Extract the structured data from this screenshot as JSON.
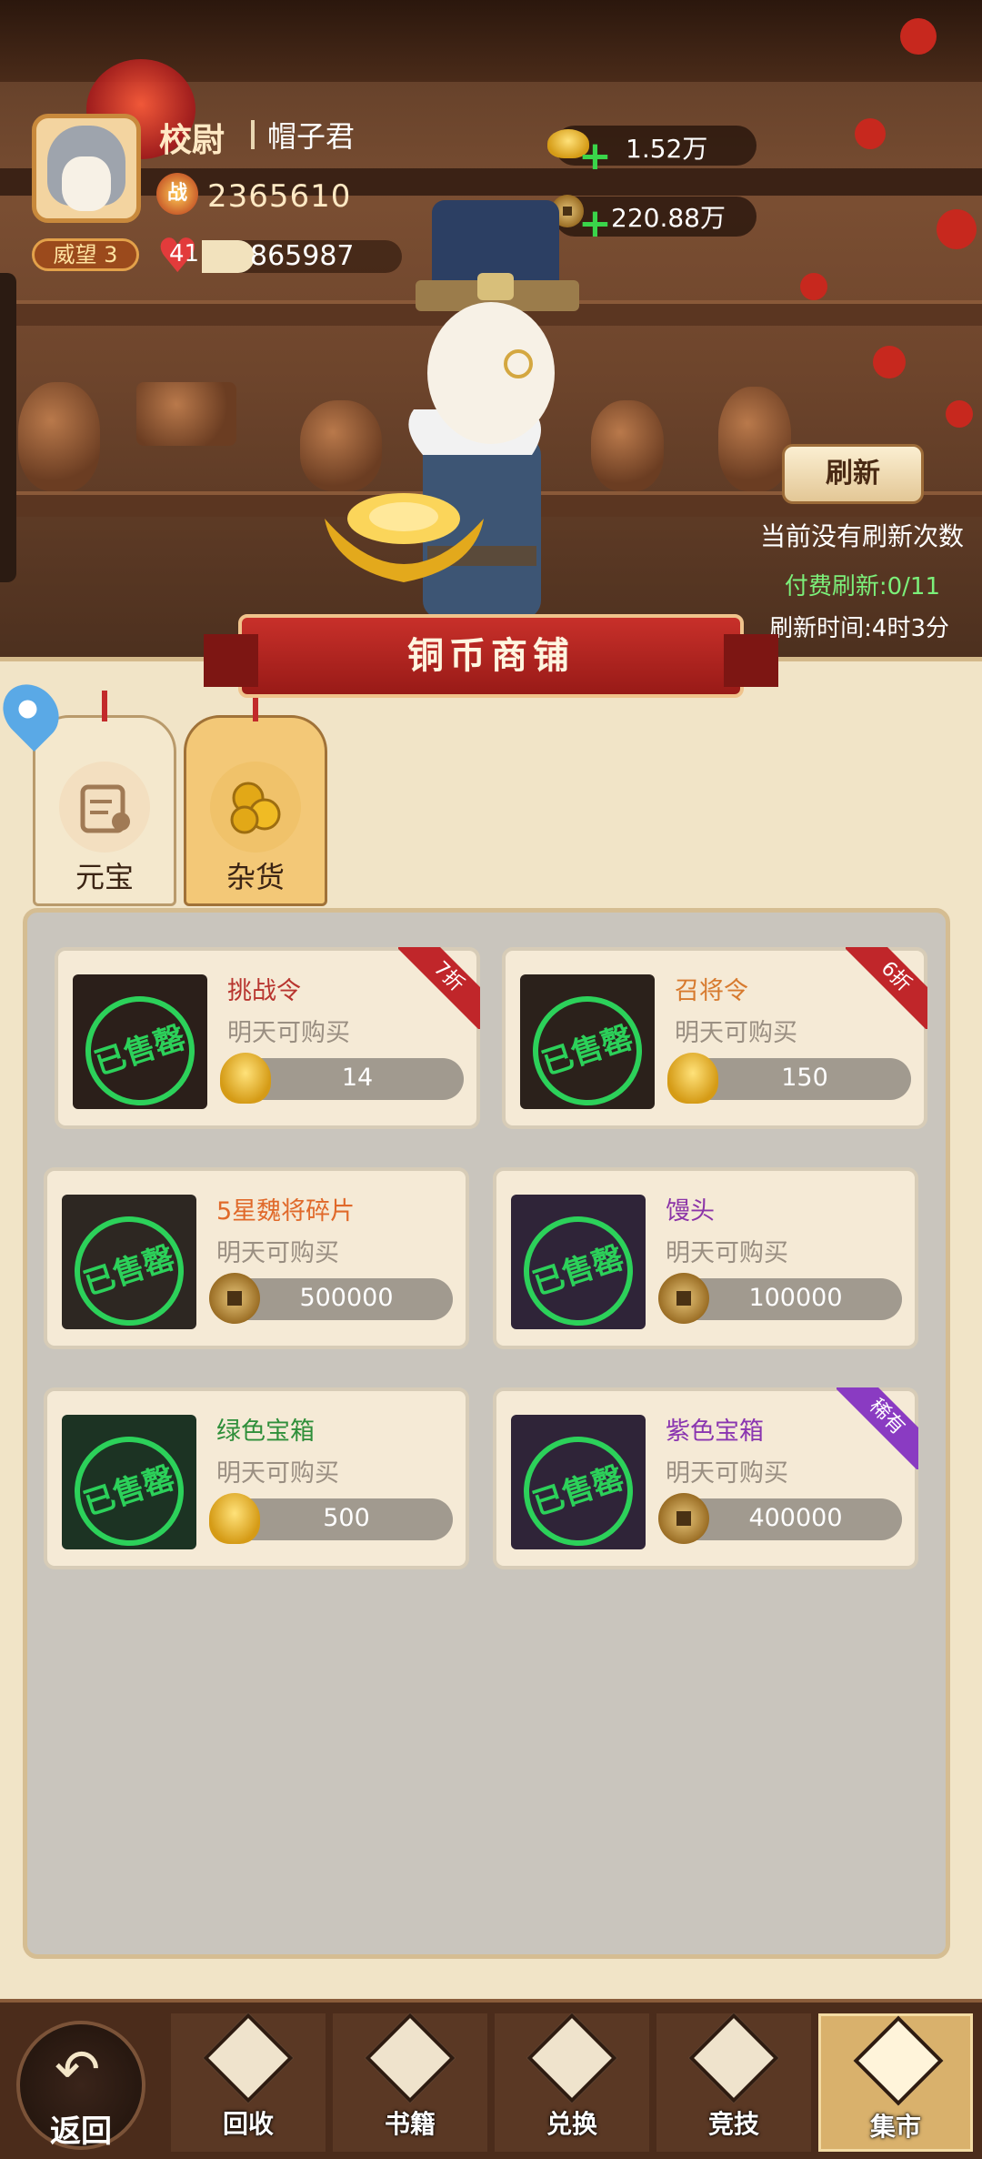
{
  "player": {
    "rank": "校尉",
    "name": "帽子君",
    "power": "2365610",
    "prestige": "威望 3",
    "stamina_level": "41",
    "stamina_value": "865987"
  },
  "currency": {
    "ingot": "1.52万",
    "coin": "220.88万"
  },
  "refresh": {
    "button": "刷新",
    "no_refresh": "当前没有刷新次数",
    "paid_refresh": "付费刷新:0/11",
    "refresh_time": "刷新时间:4时3分"
  },
  "shop_title": "铜币商铺",
  "tabs": [
    {
      "label": "元宝",
      "icon": "ledger-icon",
      "active": false
    },
    {
      "label": "杂货",
      "icon": "coins-icon",
      "active": true
    }
  ],
  "sold_stamp": "已售罄",
  "items": [
    {
      "name": "挑战令",
      "name_color": "#b8352f",
      "availability": "明天可购买",
      "currency": "ingot",
      "price": "14",
      "badge": "7折",
      "img_color": "#2b1f1a"
    },
    {
      "name": "召将令",
      "name_color": "#d77a2e",
      "availability": "明天可购买",
      "currency": "ingot",
      "price": "150",
      "badge": "6折",
      "img_color": "#2b211b"
    },
    {
      "name": "5星魏将碎片",
      "name_color": "#e0692a",
      "availability": "明天可购买",
      "currency": "coin",
      "price": "500000",
      "badge": "",
      "img_color": "#2d2722"
    },
    {
      "name": "馒头",
      "name_color": "#8c35a8",
      "availability": "明天可购买",
      "currency": "coin",
      "price": "100000",
      "badge": "",
      "img_color": "#2f2438"
    },
    {
      "name": "绿色宝箱",
      "name_color": "#2f8f3a",
      "availability": "明天可购买",
      "currency": "ingot",
      "price": "500",
      "badge": "",
      "img_color": "#1c3323"
    },
    {
      "name": "紫色宝箱",
      "name_color": "#8a35b0",
      "availability": "明天可购买",
      "currency": "coin",
      "price": "400000",
      "badge": "稀有",
      "img_color": "#2f2438"
    }
  ],
  "nav": {
    "back": "返回",
    "items": [
      {
        "label": "回收",
        "icon": "recycle-icon"
      },
      {
        "label": "书籍",
        "icon": "book-icon"
      },
      {
        "label": "兑换",
        "icon": "exchange-icon"
      },
      {
        "label": "竞技",
        "icon": "arena-icon"
      },
      {
        "label": "集市",
        "icon": "market-icon",
        "active": true
      }
    ]
  }
}
